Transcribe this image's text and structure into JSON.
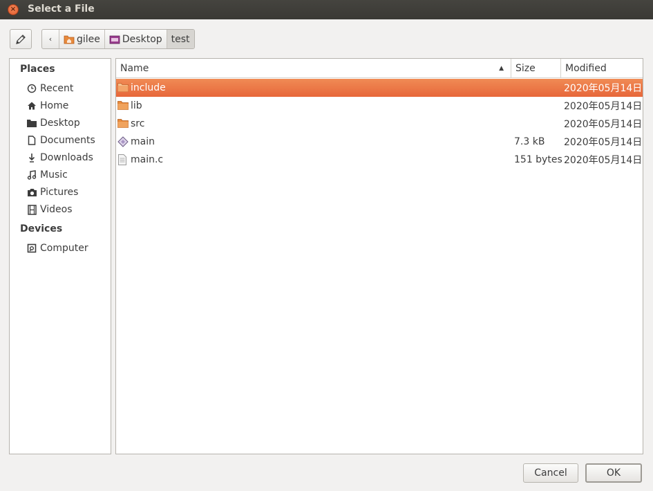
{
  "window": {
    "title": "Select a File"
  },
  "breadcrumb": {
    "items": [
      {
        "label": "gilee",
        "icon": "home-folder-icon"
      },
      {
        "label": "Desktop",
        "icon": "desktop-folder-icon"
      },
      {
        "label": "test"
      }
    ]
  },
  "sidebar": {
    "places_heading": "Places",
    "places": [
      {
        "label": "Recent",
        "icon": "clock-icon"
      },
      {
        "label": "Home",
        "icon": "home-icon"
      },
      {
        "label": "Desktop",
        "icon": "desktop-icon"
      },
      {
        "label": "Documents",
        "icon": "document-icon"
      },
      {
        "label": "Downloads",
        "icon": "download-icon"
      },
      {
        "label": "Music",
        "icon": "music-icon"
      },
      {
        "label": "Pictures",
        "icon": "camera-icon"
      },
      {
        "label": "Videos",
        "icon": "film-icon"
      }
    ],
    "devices_heading": "Devices",
    "devices": [
      {
        "label": "Computer",
        "icon": "drive-icon"
      }
    ]
  },
  "filelist": {
    "columns": {
      "name": "Name",
      "size": "Size",
      "modified": "Modified"
    },
    "rows": [
      {
        "name": "include",
        "size": "",
        "modified": "2020年05月14日",
        "type": "folder",
        "selected": true
      },
      {
        "name": "lib",
        "size": "",
        "modified": "2020年05月14日",
        "type": "folder",
        "selected": false
      },
      {
        "name": "src",
        "size": "",
        "modified": "2020年05月14日",
        "type": "folder",
        "selected": false
      },
      {
        "name": "main",
        "size": "7.3 kB",
        "modified": "2020年05月14日",
        "type": "executable",
        "selected": false
      },
      {
        "name": "main.c",
        "size": "151 bytes",
        "modified": "2020年05月14日",
        "type": "text",
        "selected": false
      }
    ]
  },
  "buttons": {
    "cancel": "Cancel",
    "ok": "OK"
  },
  "colors": {
    "selection": "#e96c3c",
    "titlebar": "#3e3d39",
    "folder": "#e88a3c"
  }
}
